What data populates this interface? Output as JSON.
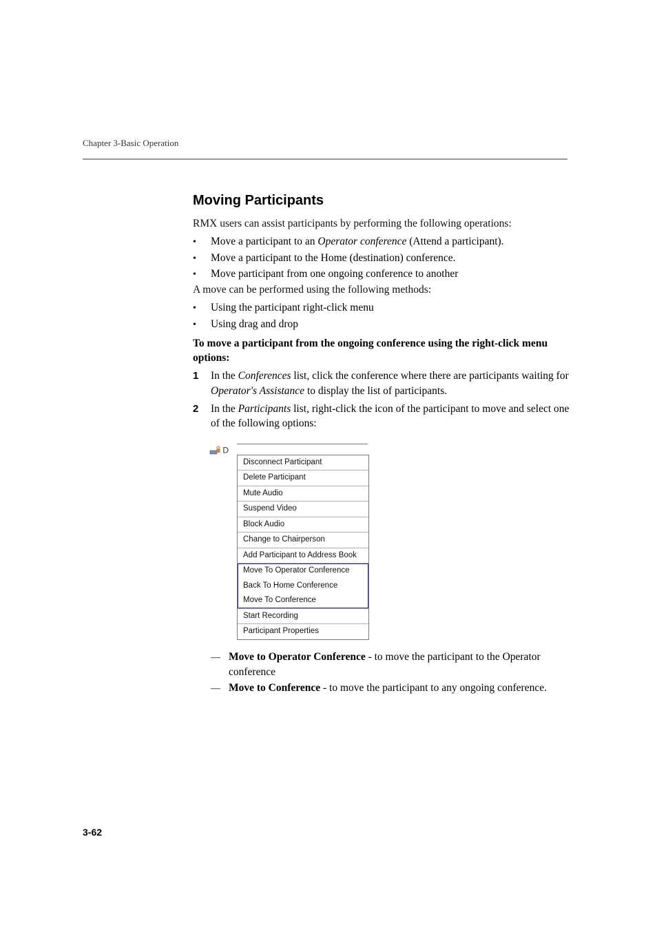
{
  "header": {
    "text": "Chapter 3-Basic Operation"
  },
  "section": {
    "title": "Moving Participants",
    "intro": "RMX users can assist participants by performing the following operations:",
    "bullets_a": [
      {
        "pre": "Move a participant to an ",
        "em": "Operator conference",
        "post": " (Attend a participant)."
      },
      {
        "pre": "Move a participant to the Home (destination) conference.",
        "em": "",
        "post": ""
      },
      {
        "pre": "Move participant from one ongoing conference to another",
        "em": "",
        "post": ""
      }
    ],
    "methods_lead": "A move can be performed using the following methods:",
    "bullets_b": [
      "Using the participant right-click menu",
      "Using drag and drop"
    ],
    "instruction": "To move a participant from the ongoing conference using the right-click menu options:",
    "steps": [
      {
        "n": "1",
        "pre": "In the ",
        "em1": "Conferences",
        "mid": " list, click the conference where there are participants waiting for ",
        "em2": "Operator's Assistance",
        "post": " to display the list of participants."
      },
      {
        "n": "2",
        "pre": "In the ",
        "em1": "Participants",
        "mid": " list, right-click the icon of the participant to move and select one of the following options:",
        "em2": "",
        "post": ""
      }
    ],
    "sub_dashes": [
      {
        "bold": "Move to Operator Conference",
        "rest": " - to move the participant to the Operator conference"
      },
      {
        "bold": "Move to Conference",
        "rest": " - to move the participant to any ongoing conference."
      }
    ]
  },
  "context_menu": {
    "stub_label": "D",
    "items": [
      {
        "label": "Disconnect Participant",
        "sep_before": false
      },
      {
        "label": "Delete Participant",
        "sep_before": true
      },
      {
        "label": "Mute Audio",
        "sep_before": true
      },
      {
        "label": "Suspend Video",
        "sep_before": true
      },
      {
        "label": "Block Audio",
        "sep_before": true
      },
      {
        "label": "Change to Chairperson",
        "sep_before": true
      },
      {
        "label": "Add Participant to Address Book",
        "sep_before": true
      },
      {
        "label": "Move To Operator Conference",
        "sep_before": true,
        "hl": true
      },
      {
        "label": "Back To Home Conference",
        "sep_before": false,
        "hl": true
      },
      {
        "label": "Move To Conference",
        "sep_before": false,
        "hl": true
      },
      {
        "label": "Start Recording",
        "sep_before": true
      },
      {
        "label": "Participant Properties",
        "sep_before": true
      }
    ]
  },
  "page_number": "3-62"
}
